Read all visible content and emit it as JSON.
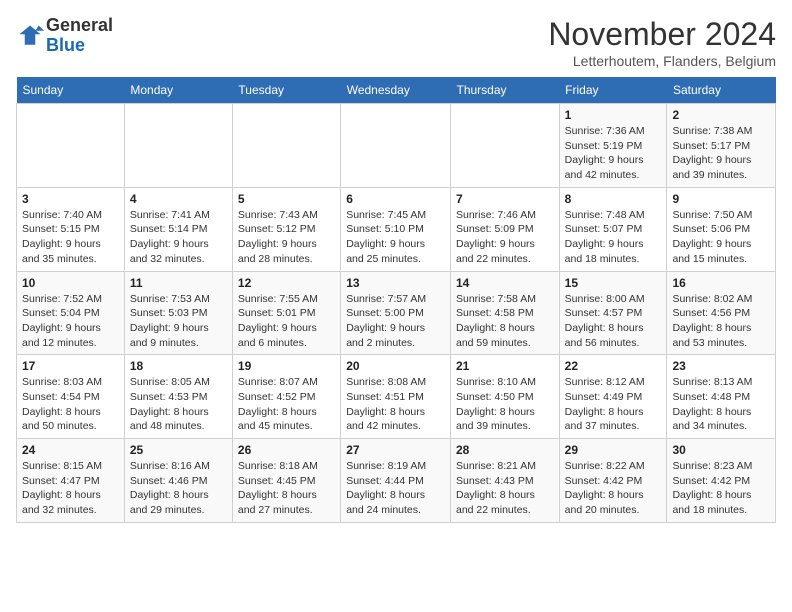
{
  "header": {
    "logo_general": "General",
    "logo_blue": "Blue",
    "month_title": "November 2024",
    "subtitle": "Letterhoutem, Flanders, Belgium"
  },
  "weekdays": [
    "Sunday",
    "Monday",
    "Tuesday",
    "Wednesday",
    "Thursday",
    "Friday",
    "Saturday"
  ],
  "weeks": [
    [
      null,
      null,
      null,
      null,
      null,
      {
        "day": "1",
        "sunrise": "Sunrise: 7:36 AM",
        "sunset": "Sunset: 5:19 PM",
        "daylight": "Daylight: 9 hours and 42 minutes."
      },
      {
        "day": "2",
        "sunrise": "Sunrise: 7:38 AM",
        "sunset": "Sunset: 5:17 PM",
        "daylight": "Daylight: 9 hours and 39 minutes."
      }
    ],
    [
      {
        "day": "3",
        "sunrise": "Sunrise: 7:40 AM",
        "sunset": "Sunset: 5:15 PM",
        "daylight": "Daylight: 9 hours and 35 minutes."
      },
      {
        "day": "4",
        "sunrise": "Sunrise: 7:41 AM",
        "sunset": "Sunset: 5:14 PM",
        "daylight": "Daylight: 9 hours and 32 minutes."
      },
      {
        "day": "5",
        "sunrise": "Sunrise: 7:43 AM",
        "sunset": "Sunset: 5:12 PM",
        "daylight": "Daylight: 9 hours and 28 minutes."
      },
      {
        "day": "6",
        "sunrise": "Sunrise: 7:45 AM",
        "sunset": "Sunset: 5:10 PM",
        "daylight": "Daylight: 9 hours and 25 minutes."
      },
      {
        "day": "7",
        "sunrise": "Sunrise: 7:46 AM",
        "sunset": "Sunset: 5:09 PM",
        "daylight": "Daylight: 9 hours and 22 minutes."
      },
      {
        "day": "8",
        "sunrise": "Sunrise: 7:48 AM",
        "sunset": "Sunset: 5:07 PM",
        "daylight": "Daylight: 9 hours and 18 minutes."
      },
      {
        "day": "9",
        "sunrise": "Sunrise: 7:50 AM",
        "sunset": "Sunset: 5:06 PM",
        "daylight": "Daylight: 9 hours and 15 minutes."
      }
    ],
    [
      {
        "day": "10",
        "sunrise": "Sunrise: 7:52 AM",
        "sunset": "Sunset: 5:04 PM",
        "daylight": "Daylight: 9 hours and 12 minutes."
      },
      {
        "day": "11",
        "sunrise": "Sunrise: 7:53 AM",
        "sunset": "Sunset: 5:03 PM",
        "daylight": "Daylight: 9 hours and 9 minutes."
      },
      {
        "day": "12",
        "sunrise": "Sunrise: 7:55 AM",
        "sunset": "Sunset: 5:01 PM",
        "daylight": "Daylight: 9 hours and 6 minutes."
      },
      {
        "day": "13",
        "sunrise": "Sunrise: 7:57 AM",
        "sunset": "Sunset: 5:00 PM",
        "daylight": "Daylight: 9 hours and 2 minutes."
      },
      {
        "day": "14",
        "sunrise": "Sunrise: 7:58 AM",
        "sunset": "Sunset: 4:58 PM",
        "daylight": "Daylight: 8 hours and 59 minutes."
      },
      {
        "day": "15",
        "sunrise": "Sunrise: 8:00 AM",
        "sunset": "Sunset: 4:57 PM",
        "daylight": "Daylight: 8 hours and 56 minutes."
      },
      {
        "day": "16",
        "sunrise": "Sunrise: 8:02 AM",
        "sunset": "Sunset: 4:56 PM",
        "daylight": "Daylight: 8 hours and 53 minutes."
      }
    ],
    [
      {
        "day": "17",
        "sunrise": "Sunrise: 8:03 AM",
        "sunset": "Sunset: 4:54 PM",
        "daylight": "Daylight: 8 hours and 50 minutes."
      },
      {
        "day": "18",
        "sunrise": "Sunrise: 8:05 AM",
        "sunset": "Sunset: 4:53 PM",
        "daylight": "Daylight: 8 hours and 48 minutes."
      },
      {
        "day": "19",
        "sunrise": "Sunrise: 8:07 AM",
        "sunset": "Sunset: 4:52 PM",
        "daylight": "Daylight: 8 hours and 45 minutes."
      },
      {
        "day": "20",
        "sunrise": "Sunrise: 8:08 AM",
        "sunset": "Sunset: 4:51 PM",
        "daylight": "Daylight: 8 hours and 42 minutes."
      },
      {
        "day": "21",
        "sunrise": "Sunrise: 8:10 AM",
        "sunset": "Sunset: 4:50 PM",
        "daylight": "Daylight: 8 hours and 39 minutes."
      },
      {
        "day": "22",
        "sunrise": "Sunrise: 8:12 AM",
        "sunset": "Sunset: 4:49 PM",
        "daylight": "Daylight: 8 hours and 37 minutes."
      },
      {
        "day": "23",
        "sunrise": "Sunrise: 8:13 AM",
        "sunset": "Sunset: 4:48 PM",
        "daylight": "Daylight: 8 hours and 34 minutes."
      }
    ],
    [
      {
        "day": "24",
        "sunrise": "Sunrise: 8:15 AM",
        "sunset": "Sunset: 4:47 PM",
        "daylight": "Daylight: 8 hours and 32 minutes."
      },
      {
        "day": "25",
        "sunrise": "Sunrise: 8:16 AM",
        "sunset": "Sunset: 4:46 PM",
        "daylight": "Daylight: 8 hours and 29 minutes."
      },
      {
        "day": "26",
        "sunrise": "Sunrise: 8:18 AM",
        "sunset": "Sunset: 4:45 PM",
        "daylight": "Daylight: 8 hours and 27 minutes."
      },
      {
        "day": "27",
        "sunrise": "Sunrise: 8:19 AM",
        "sunset": "Sunset: 4:44 PM",
        "daylight": "Daylight: 8 hours and 24 minutes."
      },
      {
        "day": "28",
        "sunrise": "Sunrise: 8:21 AM",
        "sunset": "Sunset: 4:43 PM",
        "daylight": "Daylight: 8 hours and 22 minutes."
      },
      {
        "day": "29",
        "sunrise": "Sunrise: 8:22 AM",
        "sunset": "Sunset: 4:42 PM",
        "daylight": "Daylight: 8 hours and 20 minutes."
      },
      {
        "day": "30",
        "sunrise": "Sunrise: 8:23 AM",
        "sunset": "Sunset: 4:42 PM",
        "daylight": "Daylight: 8 hours and 18 minutes."
      }
    ]
  ]
}
